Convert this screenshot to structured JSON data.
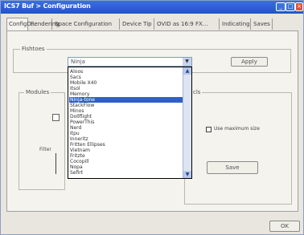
{
  "window": {
    "title": "ICS7 Buf > Configuration"
  },
  "tabs": [
    {
      "label": "ConfigD...",
      "active": true
    },
    {
      "label": "Rendering",
      "active": false
    },
    {
      "label": "Space Configuration",
      "active": false
    },
    {
      "label": "Device Tip",
      "active": false
    },
    {
      "label": "OVID as 16:9 FX...",
      "active": false
    },
    {
      "label": "Indicating",
      "active": false
    },
    {
      "label": "Saves",
      "active": false
    }
  ],
  "group_main": {
    "label": "Fishtoes"
  },
  "dropdown": {
    "selected": "Ninja",
    "items": [
      "Aloos",
      "Sacs",
      "Mobile X40",
      "Itsol",
      "Memory",
      "Ninja-tone",
      "StackFlow",
      "Minos",
      "Dollflight",
      "PowerThis",
      "Nerd",
      "Itpu",
      "Inneritz",
      "Fritten Ellipses",
      "Vietnam",
      "Fritzte",
      "Cocopill",
      "Nopa",
      "Sefirt"
    ],
    "highlighted_index": 5
  },
  "buttons": {
    "apply": "Apply",
    "test": "Save",
    "ok": "OK"
  },
  "checkbox": {
    "label": "Use maximum size",
    "checked": false
  },
  "left_labels": {
    "section": "Modules",
    "caption": "Filter"
  },
  "right_label": "cls",
  "colors": {
    "titlebar": "#2254c7",
    "highlight": "#3160c4",
    "close_button": "#d9563a"
  }
}
